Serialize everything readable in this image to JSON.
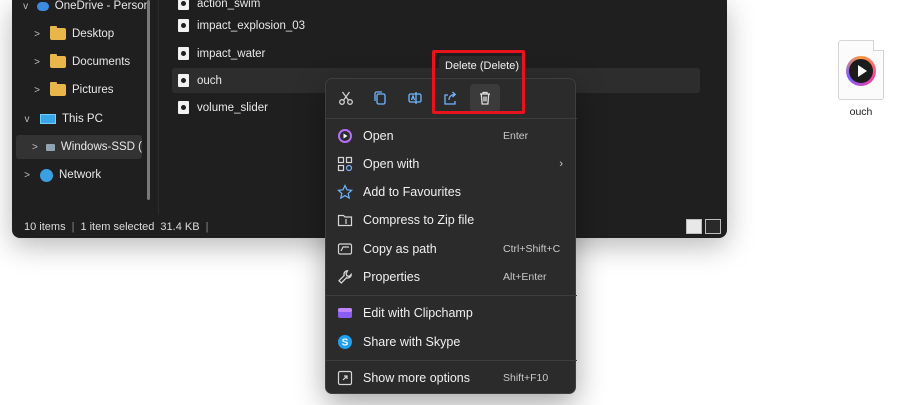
{
  "nav": {
    "items": [
      {
        "label": "OneDrive - Person",
        "chevron": "v",
        "icon": "cloud-icon"
      },
      {
        "label": "Desktop",
        "chevron": ">",
        "icon": "folder-icon"
      },
      {
        "label": "Documents",
        "chevron": ">",
        "icon": "folder-icon"
      },
      {
        "label": "Pictures",
        "chevron": ">",
        "icon": "folder-icon"
      },
      {
        "label": "This PC",
        "chevron": "v",
        "icon": "pc-icon"
      },
      {
        "label": "Windows-SSD (",
        "chevron": ">",
        "icon": "drive-icon"
      },
      {
        "label": "Network",
        "chevron": ">",
        "icon": "network-icon"
      }
    ]
  },
  "files": [
    {
      "name": "action_swim"
    },
    {
      "name": "impact_explosion_03"
    },
    {
      "name": "impact_water"
    },
    {
      "name": "ouch"
    },
    {
      "name": "volume_slider"
    }
  ],
  "status": {
    "items": "10 items",
    "selected": "1 item selected",
    "size": "31.4 KB"
  },
  "desktop_icon": {
    "label": "ouch"
  },
  "tooltip": {
    "text": "Delete (Delete)"
  },
  "quick_actions": [
    "cut-icon",
    "copy-icon",
    "rename-icon",
    "share-icon",
    "delete-icon"
  ],
  "menu": {
    "open": {
      "label": "Open",
      "shortcut": "Enter"
    },
    "open_with": {
      "label": "Open with"
    },
    "favourites": {
      "label": "Add to Favourites"
    },
    "zip": {
      "label": "Compress to Zip file"
    },
    "copy_path": {
      "label": "Copy as path",
      "shortcut": "Ctrl+Shift+C"
    },
    "properties": {
      "label": "Properties",
      "shortcut": "Alt+Enter"
    },
    "clipchamp": {
      "label": "Edit with Clipchamp"
    },
    "skype": {
      "label": "Share with Skype"
    },
    "more": {
      "label": "Show more options",
      "shortcut": "Shift+F10"
    }
  },
  "colors": {
    "highlight": "#e8141d",
    "menu_bg": "#2b2b2b",
    "explorer_bg": "#1f1f1f"
  }
}
